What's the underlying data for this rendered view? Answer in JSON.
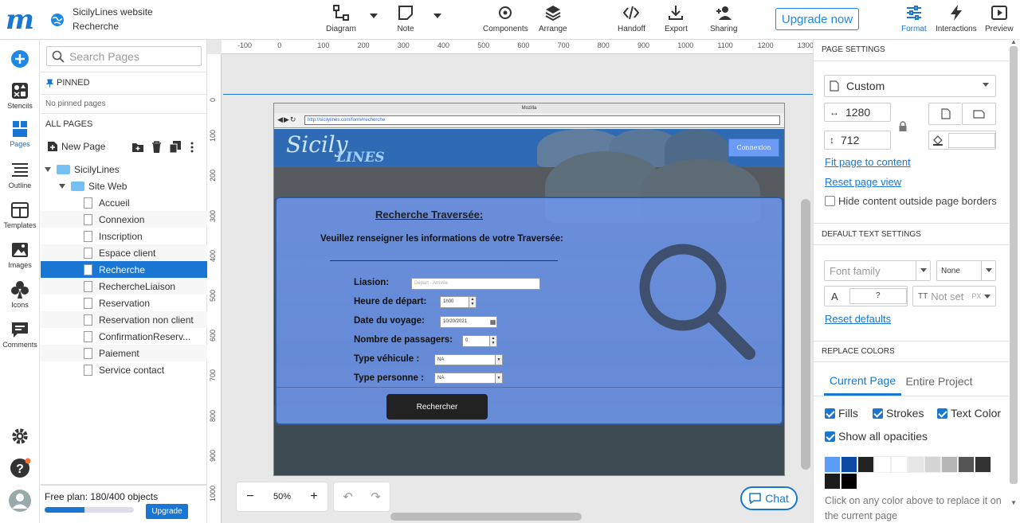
{
  "app": {
    "logo": "m",
    "project_title": "SicilyLines website",
    "current_page": "Recherche"
  },
  "toolbar": {
    "diagram": "Diagram",
    "note": "Note",
    "components": "Components",
    "arrange": "Arrange",
    "handoff": "Handoff",
    "export": "Export",
    "sharing": "Sharing",
    "upgrade": "Upgrade now",
    "format": "Format",
    "interactions": "Interactions",
    "preview": "Preview"
  },
  "leftbar": {
    "stencils": "Stencils",
    "pages": "Pages",
    "outline": "Outline",
    "templates": "Templates",
    "images": "Images",
    "icons": "Icons",
    "comments": "Comments"
  },
  "pages_panel": {
    "search_placeholder": "Search Pages",
    "pinned_header": "PINNED",
    "no_pinned": "No pinned pages",
    "all_pages_header": "ALL PAGES",
    "new_page": "New Page",
    "root_folder": "SicilyLines",
    "sub_folder": "Site Web",
    "pages": [
      "Accueil",
      "Connexion",
      "Inscription",
      "Espace client",
      "Recherche",
      "RechercheLiaison",
      "Reservation",
      "Reservation non client",
      "ConfirmationReserv...",
      "Paiement",
      "Service contact"
    ],
    "selected_index": 4,
    "plan_text": "Free plan: 180/400 objects",
    "plan_progress": 0.45,
    "upgrade": "Upgrade"
  },
  "ruler": {
    "top": [
      "-100",
      "0",
      "100",
      "200",
      "300",
      "400",
      "500",
      "600",
      "700",
      "800",
      "900",
      "1000",
      "1100",
      "1200",
      "1300"
    ],
    "left": [
      "0",
      "100",
      "200",
      "300",
      "400",
      "500",
      "600",
      "700",
      "800",
      "900",
      "1000"
    ]
  },
  "mockup": {
    "browser_title": "Mozilla",
    "url": "http://sicilylines.com/form#recherche",
    "logo_sicily": "Sicily",
    "logo_lines": "LINES",
    "connexion": "Connexion",
    "form_title": "Recherche Traversée:",
    "form_subtitle": "Veuillez renseigner les informations de votre Traversée:",
    "labels": [
      "Liasion:",
      "Heure de départ:",
      "Date du voyage:",
      "Nombre de passagers:",
      "Type véhicule :",
      "Type personne :"
    ],
    "liaison_placeholder": "Départ - Arrivée",
    "heure_value": "1h00",
    "date_value": "10/20/2021",
    "passagers_value": "0",
    "vehicule_value": "NA",
    "personne_value": "NA",
    "search_button": "Rechercher"
  },
  "canvas_controls": {
    "zoom": "50%",
    "chat": "Chat"
  },
  "right_panel": {
    "page_settings_header": "PAGE SETTINGS",
    "size_preset": "Custom",
    "width": "1280",
    "height": "712",
    "fit_page": "Fit page to content",
    "reset_view": "Reset page view",
    "hide_outside": "Hide content outside page borders",
    "default_text_header": "DEFAULT TEXT SETTINGS",
    "font_family_placeholder": "Font family",
    "font_style": "None",
    "font_size": "?",
    "line_height": "Not set",
    "line_height_unit": "PX",
    "reset_defaults": "Reset defaults",
    "replace_colors_header": "REPLACE COLORS",
    "tab_current": "Current Page",
    "tab_entire": "Entire Project",
    "fills": "Fills",
    "strokes": "Strokes",
    "text_color": "Text Color",
    "show_opacities": "Show all opacities",
    "swatches": [
      "#5b9cf5",
      "#0d4aa6",
      "#222222",
      "#ffffff",
      "#ffffff",
      "#e6e6e6",
      "#d4d4d4",
      "#b5b5b5",
      "#555555",
      "#333333",
      "#1c1c1c",
      "#000000"
    ],
    "replace_hint": "Click on any color above to replace it on the current page"
  }
}
